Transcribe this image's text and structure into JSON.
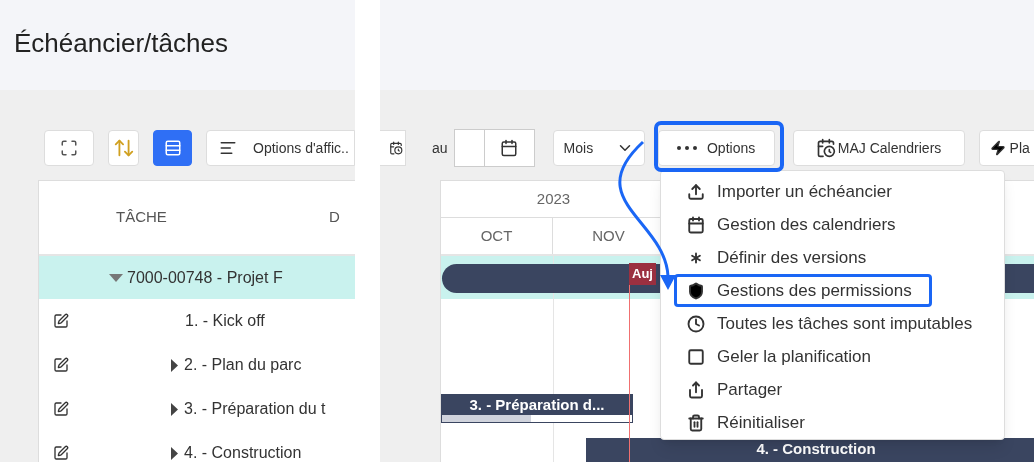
{
  "title": "Échéancier/tâches",
  "view_buttons": [
    {
      "selected": false
    },
    {
      "selected": false
    },
    {
      "selected": true
    }
  ],
  "display_options_button": "Options d'affic..",
  "date_range": {
    "to_label": "au"
  },
  "period_select": "Mois",
  "options_button": {
    "label": "Options",
    "highlighted": true
  },
  "calendar_update_button": "MAJ Calendriers",
  "plan_button": "Pla",
  "table": {
    "columns": [
      "TÂCHE",
      "D"
    ],
    "rows": [
      {
        "label": "7000-00748 - Projet F",
        "expandable": true,
        "expanded": true,
        "editable": false,
        "selected": true
      },
      {
        "label": "1. - Kick off",
        "expandable": false,
        "editable": true,
        "selected": false
      },
      {
        "label": "2. - Plan du parc",
        "expandable": true,
        "expanded": false,
        "editable": true,
        "selected": false
      },
      {
        "label": "3. - Préparation du t",
        "expandable": true,
        "expanded": false,
        "editable": true,
        "selected": false
      },
      {
        "label": "4. - Construction",
        "expandable": true,
        "expanded": false,
        "editable": true,
        "selected": false
      }
    ]
  },
  "timeline": {
    "year": "2023",
    "months": [
      "OCT",
      "NOV"
    ],
    "today_label": "Auj",
    "bars": [
      {
        "kind": "summary"
      },
      {
        "kind": "task",
        "label": "3. - Préparation d...",
        "level": 0.47
      },
      {
        "kind": "task",
        "label": "4. - Construction"
      }
    ]
  },
  "options_menu": [
    {
      "label": "Importer un échéancier",
      "selected": false
    },
    {
      "label": "Gestion des calendriers",
      "selected": false
    },
    {
      "label": "Définir des versions",
      "selected": false
    },
    {
      "label": "Gestions des permissions",
      "selected": true
    },
    {
      "label": "Toutes les tâches sont imputables",
      "selected": false
    },
    {
      "label": "Geler la planification",
      "selected": false
    },
    {
      "label": "Partager",
      "selected": false
    },
    {
      "label": "Réinitialiser",
      "selected": false
    }
  ]
}
